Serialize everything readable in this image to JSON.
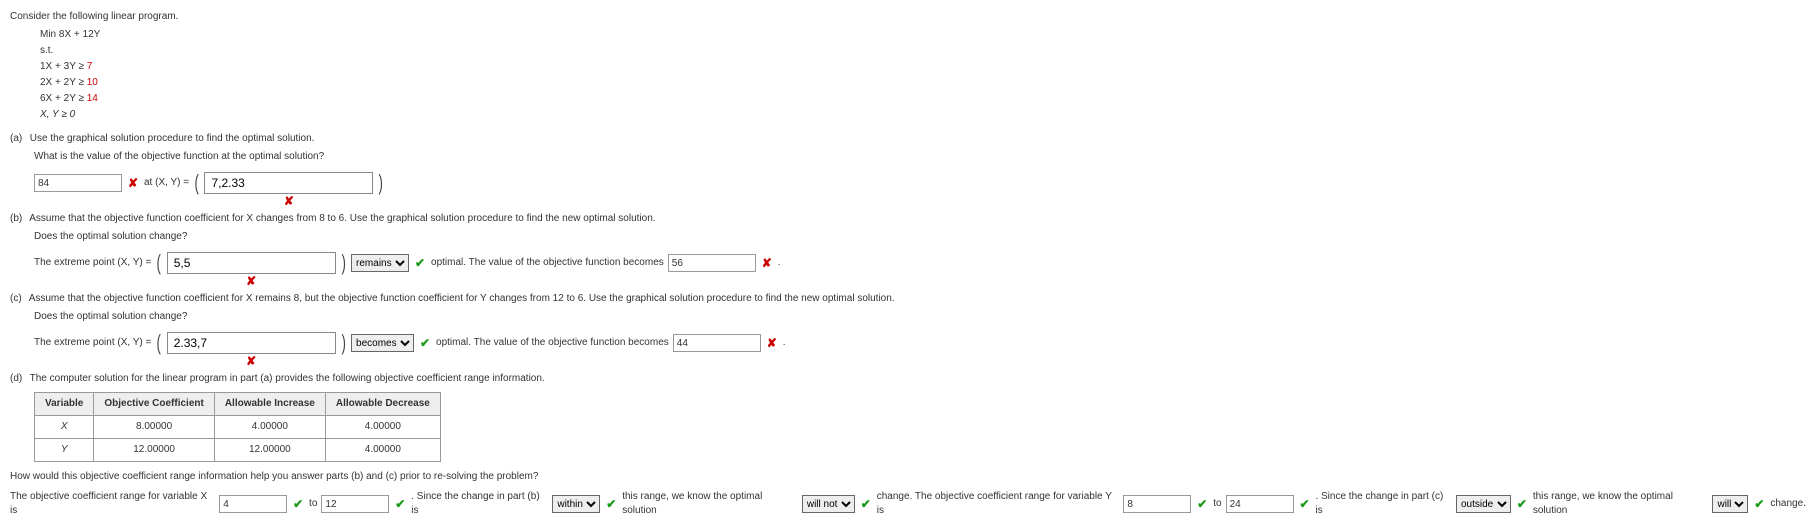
{
  "intro": "Consider the following linear program.",
  "lp": {
    "obj": "Min 8X + 12Y",
    "st": "s.t.",
    "c1a": "1X + 3Y  ≥ ",
    "c1b": "7",
    "c2a": "2X + 2Y  ≥ ",
    "c2b": "10",
    "c3a": "6X + 2Y  ≥ ",
    "c3b": "14",
    "c4": "X, Y ≥ 0"
  },
  "a": {
    "label": "(a)",
    "q1": "Use the graphical solution procedure to find the optimal solution.",
    "q2": "What is the value of the objective function at the optimal solution?",
    "obj_val": "84",
    "at": " at (X, Y) = ",
    "xy": "7,2.33"
  },
  "b": {
    "label": "(b)",
    "q1": "Assume that the objective function coefficient for X changes from 8 to 6. Use the graphical solution procedure to find the new optimal solution.",
    "q2": "Does the optimal solution change?",
    "lead": "The extreme point (X, Y) = ",
    "xy": "5,5",
    "sel": "remains",
    "mid": " optimal. The value of the objective function becomes ",
    "val": "56",
    "tail": " ."
  },
  "c": {
    "label": "(c)",
    "q1": "Assume that the objective function coefficient for X remains 8, but the objective function coefficient for Y changes from 12 to 6. Use the graphical solution procedure to find the new optimal solution.",
    "q2": "Does the optimal solution change?",
    "lead": "The extreme point (X, Y) = ",
    "xy": "2.33,7",
    "sel": "becomes",
    "mid": " optimal. The value of the objective function becomes ",
    "val": "44",
    "tail": " ."
  },
  "d": {
    "label": "(d)",
    "q1": "The computer solution for the linear program in part (a) provides the following objective coefficient range information.",
    "table": {
      "h1": "Variable",
      "h2": "Objective Coefficient",
      "h3": "Allowable Increase",
      "h4": "Allowable Decrease",
      "r1c1": "X",
      "r1c2": "8.00000",
      "r1c3": "4.00000",
      "r1c4": "4.00000",
      "r2c1": "Y",
      "r2c2": "12.00000",
      "r2c3": "12.00000",
      "r2c4": "4.00000"
    },
    "q2": "How would this objective coefficient range information help you answer parts (b) and (c) prior to re-solving the problem?",
    "s1": "The objective coefficient range for variable X is ",
    "xlo": "4",
    "to": " to ",
    "xhi": "12",
    "s2": " . Since the change in part (b) is ",
    "sel_b": "within",
    "s3": " this range, we know the optimal solution ",
    "sel_b2": "will not",
    "s4": " change. The objective coefficient range for variable Y is ",
    "ylo": "8",
    "yhi": "24",
    "s5": " . Since the change in part (c) is ",
    "sel_c": "outside",
    "s6": " this range, we know the optimal solution ",
    "sel_c2": "will",
    "s7": " change."
  },
  "marks": {
    "ok": "✔",
    "bad": "✘"
  }
}
